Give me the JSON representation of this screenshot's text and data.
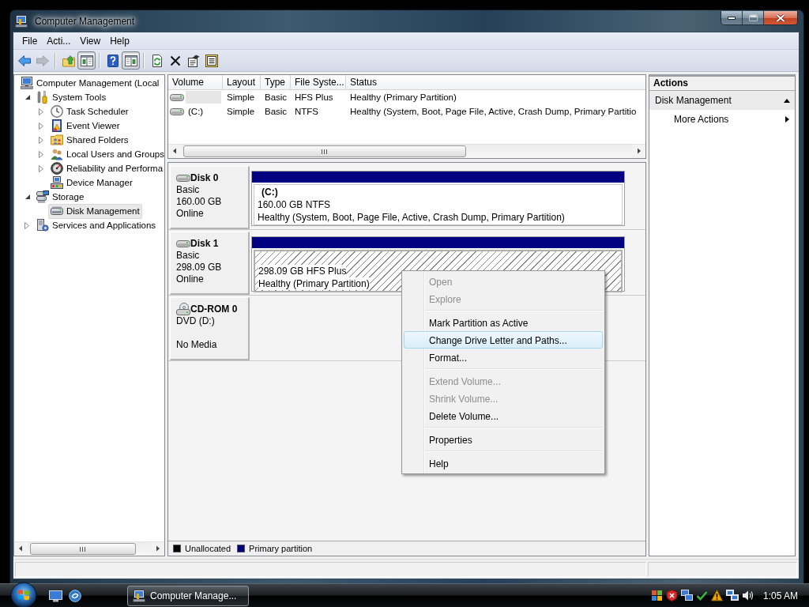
{
  "window": {
    "title": "Computer Management"
  },
  "menu": [
    "File",
    "Acti...",
    "View",
    "Help"
  ],
  "toolbar": [
    {
      "kind": "back",
      "pressed": false,
      "disabled": false
    },
    {
      "kind": "forward",
      "pressed": false,
      "disabled": true
    },
    {
      "kind": "separator"
    },
    {
      "kind": "up",
      "pressed": false,
      "disabled": false
    },
    {
      "kind": "tree-pane",
      "pressed": true,
      "disabled": false
    },
    {
      "kind": "separator"
    },
    {
      "kind": "help",
      "pressed": false,
      "disabled": false
    },
    {
      "kind": "action-pane",
      "pressed": true,
      "disabled": false
    },
    {
      "kind": "separator"
    },
    {
      "kind": "refresh",
      "pressed": false,
      "disabled": false
    },
    {
      "kind": "delete",
      "pressed": false,
      "disabled": false
    },
    {
      "kind": "properties",
      "pressed": false,
      "disabled": false
    },
    {
      "kind": "export",
      "pressed": false,
      "disabled": false
    }
  ],
  "tree": [
    {
      "label": "Computer Management (Local",
      "kind": "computer",
      "selected": false,
      "children": [
        {
          "label": "System Tools",
          "kind": "tools",
          "expanded": true,
          "selected": false,
          "children": [
            {
              "label": "Task Scheduler",
              "kind": "clock",
              "expanded": false,
              "selected": false
            },
            {
              "label": "Event Viewer",
              "kind": "event-log",
              "expanded": false,
              "selected": false
            },
            {
              "label": "Shared Folders",
              "kind": "shared-folder",
              "expanded": false,
              "selected": false
            },
            {
              "label": "Local Users and Groups",
              "kind": "users",
              "expanded": false,
              "selected": false
            },
            {
              "label": "Reliability and Performa",
              "kind": "gauge",
              "expanded": false,
              "selected": false
            },
            {
              "label": "Device Manager",
              "kind": "device",
              "selected": false
            }
          ]
        },
        {
          "label": "Storage",
          "kind": "storage",
          "expanded": true,
          "selected": false,
          "children": [
            {
              "label": "Disk Management",
              "kind": "disk",
              "selected": true
            }
          ]
        },
        {
          "label": "Services and Applications",
          "kind": "services",
          "expanded": false,
          "selected": false
        }
      ]
    }
  ],
  "volume_list": {
    "columns": [
      "Volume",
      "Layout",
      "Type",
      "File Syste...",
      "Status"
    ],
    "rows": [
      {
        "selected": true,
        "layout": "Simple",
        "type": "Basic",
        "file_system": "HFS Plus",
        "status": "Healthy (Primary Partition)"
      },
      {
        "selected": false,
        "volume": "(C:)",
        "layout": "Simple",
        "type": "Basic",
        "file_system": "NTFS",
        "status": "Healthy (System, Boot, Page File, Active, Crash Dump, Primary Partitio"
      }
    ]
  },
  "disks": [
    {
      "kind": "hard-disk",
      "name": "Disk 0",
      "type": "Basic",
      "size": "160.00 GB",
      "status": "Online",
      "partitions": [
        {
          "label": "(C:)",
          "size": "160.00 GB NTFS",
          "status": "Healthy (System, Boot, Page File, Active, Crash Dump, Primary Partition)",
          "color": "#000080",
          "selected": false
        }
      ]
    },
    {
      "kind": "hard-disk",
      "name": "Disk 1",
      "type": "Basic",
      "size": "298.09 GB",
      "status": "Online",
      "partitions": [
        {
          "size": "298.09 GB HFS Plus",
          "status": "Healthy (Primary Partition)",
          "color": "#000080",
          "selected": true
        }
      ]
    },
    {
      "kind": "cd-rom",
      "name": "CD-ROM 0",
      "type": "DVD (D:)",
      "status": "No Media"
    }
  ],
  "legend": [
    {
      "label": "Unallocated",
      "color": "#000000"
    },
    {
      "label": "Primary partition",
      "color": "#000080"
    }
  ],
  "actions": {
    "title": "Actions",
    "sections": [
      {
        "label": "Disk Management",
        "expanded": true,
        "items": [
          {
            "label": "More Actions",
            "submenu": true
          }
        ]
      }
    ]
  },
  "context_menu": {
    "items": [
      {
        "kind": "item",
        "label": "Open",
        "disabled": true,
        "selected": false
      },
      {
        "kind": "item",
        "label": "Explore",
        "disabled": true,
        "selected": false
      },
      {
        "kind": "separator"
      },
      {
        "kind": "item",
        "label": "Mark Partition as Active",
        "disabled": false,
        "selected": false
      },
      {
        "kind": "item",
        "label": "Change Drive Letter and Paths...",
        "disabled": false,
        "selected": true
      },
      {
        "kind": "item",
        "label": "Format...",
        "disabled": false,
        "selected": false
      },
      {
        "kind": "separator"
      },
      {
        "kind": "item",
        "label": "Extend Volume...",
        "disabled": true,
        "selected": false
      },
      {
        "kind": "item",
        "label": "Shrink Volume...",
        "disabled": true,
        "selected": false
      },
      {
        "kind": "item",
        "label": "Delete Volume...",
        "disabled": false,
        "selected": false
      },
      {
        "kind": "separator"
      },
      {
        "kind": "item",
        "label": "Properties",
        "disabled": false,
        "selected": false
      },
      {
        "kind": "separator"
      },
      {
        "kind": "item",
        "label": "Help",
        "disabled": false,
        "selected": false
      }
    ]
  },
  "taskbar": {
    "tasks": [
      {
        "label": "Computer Manage...",
        "selected": true
      }
    ],
    "clock": "1:05 AM"
  }
}
